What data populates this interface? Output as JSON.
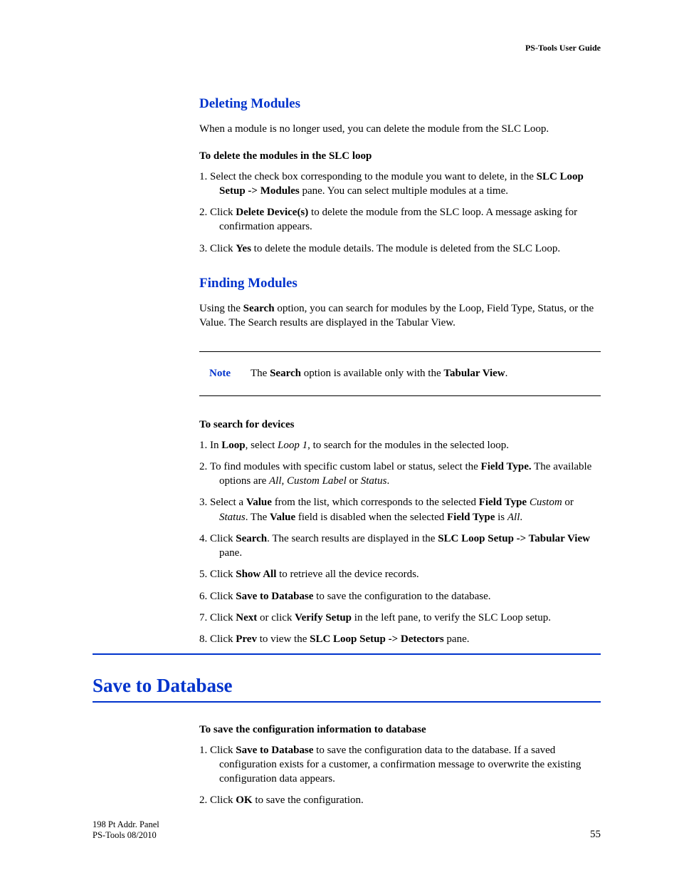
{
  "header": {
    "running": "PS-Tools User Guide"
  },
  "section1": {
    "title": "Deleting Modules",
    "intro": "When a module is no longer used, you can delete the module from the SLC Loop.",
    "subhead": "To delete the modules in the SLC loop",
    "steps": {
      "s1a": "Select the check box corresponding to the module you want to delete, in the ",
      "s1b": "SLC Loop Setup -> Modules",
      "s1c": " pane. You can select multiple modules at a time.",
      "s2a": "Click ",
      "s2b": "Delete Device(s)",
      "s2c": " to delete the module from the SLC loop. A message asking for confirmation appears.",
      "s3a": "Click ",
      "s3b": "Yes",
      "s3c": " to delete the module details. The module is deleted from the SLC Loop."
    }
  },
  "section2": {
    "title": "Finding Modules",
    "intro_a": "Using the ",
    "intro_b": "Search",
    "intro_c": " option, you can search for modules by the Loop, Field Type, Status, or the Value. The Search results are displayed in the Tabular View.",
    "note": {
      "label": "Note",
      "a": "The ",
      "b": "Search",
      "c": " option is available only with the ",
      "d": "Tabular View",
      "e": "."
    },
    "subhead": "To search for devices",
    "steps": {
      "s1a": "In ",
      "s1b": "Loop",
      "s1c": ", select ",
      "s1d": "Loop 1",
      "s1e": ", to search for the modules in the selected loop.",
      "s2a": "To find modules with specific custom label or status, select the ",
      "s2b": "Field Type.",
      "s2c": " The available options are ",
      "s2d": "All",
      "s2e": ", ",
      "s2f": "Custom Label",
      "s2g": " or ",
      "s2h": "Status",
      "s2i": ".",
      "s3a": "Select a ",
      "s3b": "Value",
      "s3c": " from the list, which corresponds to the selected ",
      "s3d": "Field Type",
      "s3e": " ",
      "s3f": "Custom",
      "s3g": " or ",
      "s3h": "Status",
      "s3i": ". The ",
      "s3j": "Value",
      "s3k": " field is disabled when the selected ",
      "s3l": "Field Type",
      "s3m": " is ",
      "s3n": "All",
      "s3o": ".",
      "s4a": "Click ",
      "s4b": "Search",
      "s4c": ". The search results are displayed in the ",
      "s4d": "SLC Loop Setup -> Tabular View",
      "s4e": " pane.",
      "s5a": "Click ",
      "s5b": "Show All",
      "s5c": " to retrieve all the device records.",
      "s6a": "Click ",
      "s6b": "Save to Database",
      "s6c": " to save the configuration to the database.",
      "s7a": "Click ",
      "s7b": "Next",
      "s7c": " or click ",
      "s7d": "Verify Setup",
      "s7e": " in the left pane, to verify the SLC Loop setup.",
      "s8a": "Click ",
      "s8b": "Prev",
      "s8c": " to view the ",
      "s8d": "SLC Loop Setup -> Detectors",
      "s8e": " pane."
    }
  },
  "section3": {
    "title": "Save to Database",
    "subhead": "To save the configuration information to database",
    "steps": {
      "s1a": "Click ",
      "s1b": "Save to Database",
      "s1c": " to save the configuration data to the database. If a saved configuration exists for a customer, a confirmation message to overwrite the existing configuration data appears.",
      "s2a": "Click ",
      "s2b": "OK",
      "s2c": " to save the configuration."
    }
  },
  "footer": {
    "left1": "198 Pt Addr. Panel",
    "left2": "PS-Tools  08/2010",
    "page": "55"
  }
}
